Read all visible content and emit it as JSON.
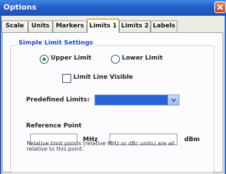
{
  "window": {
    "title": "Options"
  },
  "tabs": [
    {
      "label": "Scale",
      "active": false
    },
    {
      "label": "Units",
      "active": false
    },
    {
      "label": "Markers",
      "active": false
    },
    {
      "label": "Limits 1",
      "active": true
    },
    {
      "label": "Limits 2",
      "active": false
    },
    {
      "label": "Labels",
      "active": false
    }
  ],
  "simple_limit_settings": {
    "group_label": "Simple Limit Settings",
    "upper_limit": {
      "label": "Upper Limit",
      "selected": true
    },
    "lower_limit": {
      "label": "Lower Limit",
      "selected": false
    },
    "limit_line_visible": {
      "label": "Limit Line Visible",
      "checked": false
    },
    "predefined_limits": {
      "label": "Predefined Limits:",
      "value": ""
    },
    "reference_point": {
      "label": "Reference Point",
      "mhz_value": "",
      "mhz_unit": "MHz",
      "dbm_value": "",
      "dbm_unit": "dBm",
      "note": "Relative limit points (relative MHz or dBc units) are all relative to this point."
    }
  },
  "colors": {
    "titlebar": "#2460c8",
    "group_label": "#1e46d2",
    "active_tab_accent": "#f2b43b",
    "dropdown_fill": "#2a62d8"
  }
}
